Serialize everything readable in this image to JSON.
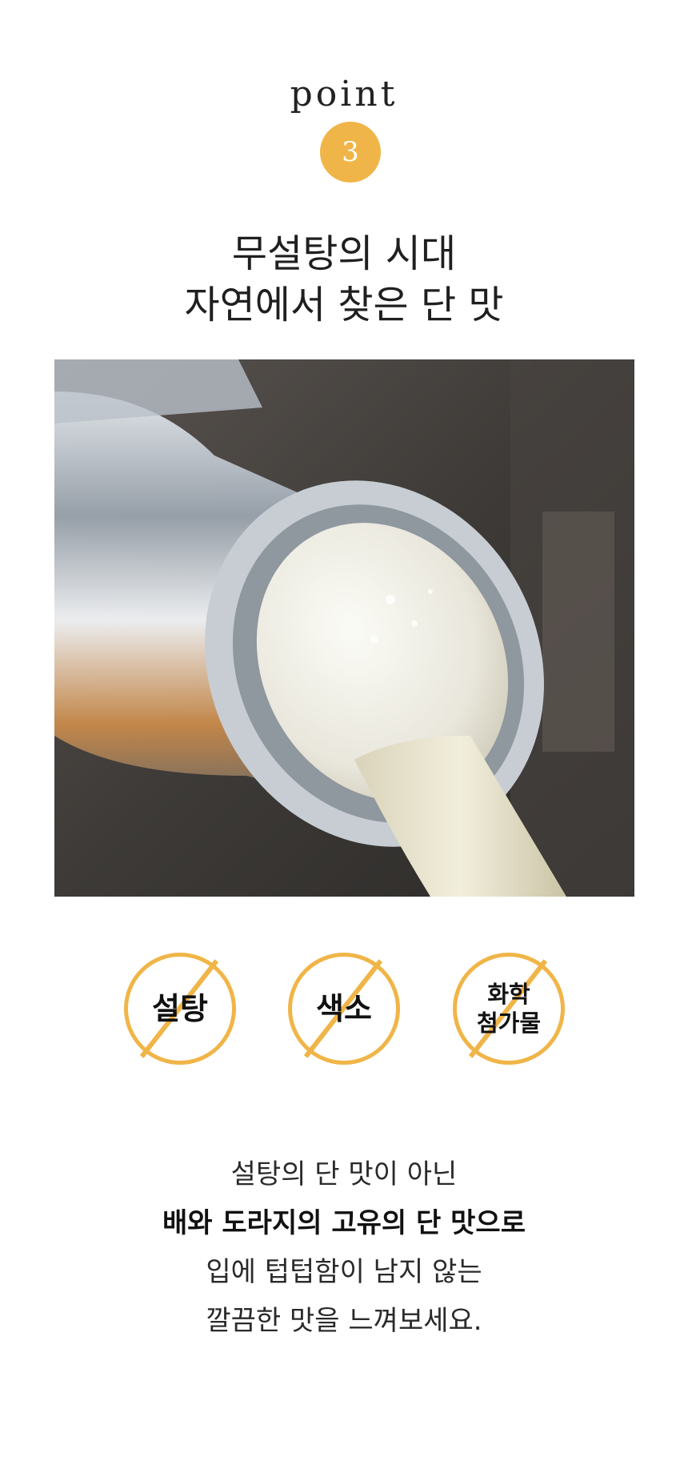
{
  "point": {
    "label": "point",
    "number": "3"
  },
  "headline": {
    "line1": "무설탕의 시대",
    "line2": "자연에서 찾은 단 맛"
  },
  "photo": {
    "alt": ""
  },
  "badges": [
    {
      "text": "설탕"
    },
    {
      "text": "색소"
    },
    {
      "line1": "화학",
      "line2": "첨가물"
    }
  ],
  "description": {
    "line1": "설탕의 단 맛이 아닌",
    "line2": "배와 도라지의 고유의 단 맛으로",
    "line3": "입에 텁텁함이 남지 않는",
    "line4": "깔끔한 맛을 느껴보세요."
  },
  "colors": {
    "accent": "#f0b548"
  }
}
